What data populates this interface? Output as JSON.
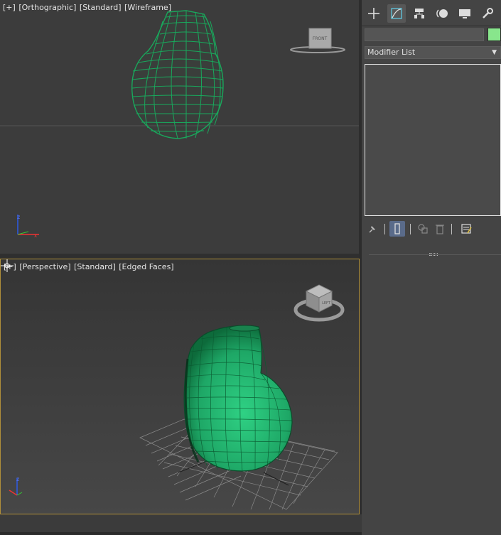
{
  "viewports": {
    "top": {
      "label_parts": [
        "[+]",
        "[Orthographic]",
        "[Standard]",
        "[Wireframe]"
      ],
      "viewcube_face": "FRONT",
      "shading": "wireframe"
    },
    "perspective": {
      "label_parts": [
        "[+]",
        "[Perspective]",
        "[Standard]",
        "[Edged Faces]"
      ],
      "viewcube_face": "LEFT",
      "shading": "edged-faces",
      "active": true
    }
  },
  "colors": {
    "object": "#1fb36a",
    "object_dark": "#0c6e3a",
    "wire": "#17a35a",
    "active_border": "#b08f3a",
    "swatch": "#88e68c"
  },
  "command_panel": {
    "tabs": [
      {
        "name": "create",
        "icon": "plus-icon"
      },
      {
        "name": "modify",
        "icon": "modify-curve-icon",
        "active": true
      },
      {
        "name": "hierarchy",
        "icon": "hierarchy-icon"
      },
      {
        "name": "motion",
        "icon": "motion-icon"
      },
      {
        "name": "display",
        "icon": "display-monitor-icon"
      },
      {
        "name": "utilities",
        "icon": "wrench-icon"
      }
    ],
    "object_name": "",
    "modifier_list_label": "Modifier List",
    "stack_items": [],
    "stack_tools": [
      "pin-stack-icon",
      "show-end-result-icon",
      "make-unique-icon",
      "remove-modifier-icon",
      "configure-modifier-sets-icon"
    ]
  }
}
